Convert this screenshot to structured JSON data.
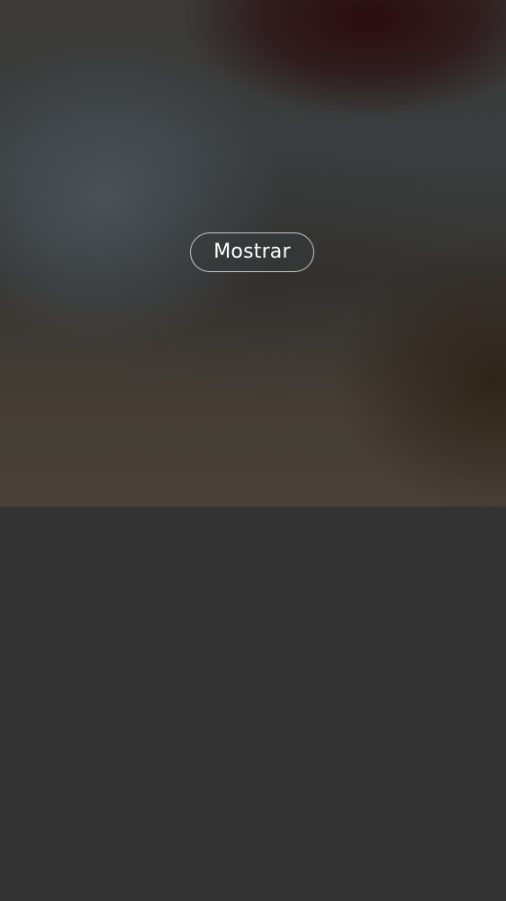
{
  "media": {
    "reveal_label": "Mostrar"
  }
}
